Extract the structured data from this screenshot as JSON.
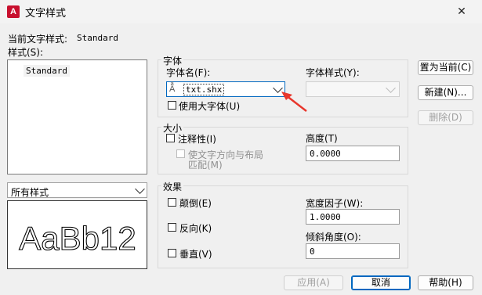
{
  "window": {
    "title": "文字样式",
    "app_icon_letter": "A"
  },
  "current_style": {
    "label": "当前文字样式:",
    "value": "Standard"
  },
  "styles": {
    "label": "样式(S):",
    "items": [
      "Standard"
    ]
  },
  "filter": {
    "value": "所有样式"
  },
  "preview": {
    "text": "AaBb12"
  },
  "font_group": {
    "title": "字体",
    "font_name_label": "字体名(F):",
    "font_name_value": "txt.shx",
    "font_style_label": "字体样式(Y):",
    "font_style_value": "",
    "use_big_font_label": "使用大字体(U)"
  },
  "size_group": {
    "title": "大小",
    "annotative_label": "注释性(I)",
    "match_layout_label_1": "使文字方向与布局",
    "match_layout_label_2": "匹配(M)",
    "height_label": "高度(T)",
    "height_value": "0.0000"
  },
  "effects_group": {
    "title": "效果",
    "upside_down_label": "颠倒(E)",
    "backwards_label": "反向(K)",
    "vertical_label": "垂直(V)",
    "width_factor_label": "宽度因子(W):",
    "width_factor_value": "1.0000",
    "oblique_label": "倾斜角度(O):",
    "oblique_value": "0"
  },
  "buttons": {
    "set_current": "置为当前(C)",
    "new": "新建(N)...",
    "delete": "删除(D)",
    "apply": "应用(A)",
    "cancel": "取消",
    "help": "帮助(H)"
  },
  "colors": {
    "app_icon": "#c8102e",
    "annotation_arrow": "#e8362c",
    "primary_border": "#0067c0"
  }
}
